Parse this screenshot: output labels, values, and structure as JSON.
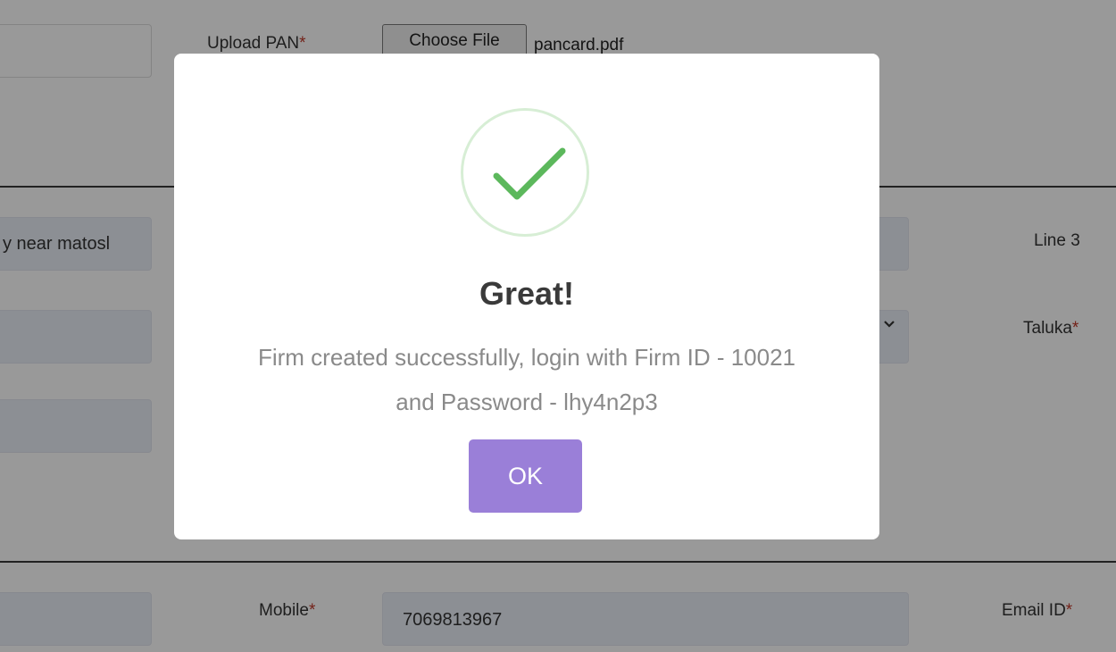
{
  "form": {
    "upload_pan_label": "Upload PAN",
    "required_mark": "*",
    "choose_file_label": "Choose File",
    "file_name": "pancard.pdf",
    "address_line1_value": "y near matosl",
    "line3_label": "Line 3",
    "taluka_label": "Taluka",
    "mobile_label": "Mobile",
    "mobile_value": "7069813967",
    "email_label": "Email ID"
  },
  "modal": {
    "title": "Great!",
    "message_line1": "Firm created successfully, login with Firm ID - 10021",
    "message_line2": "and Password - lhy4n2p3",
    "ok_label": "OK",
    "icon": "checkmark-icon"
  },
  "colors": {
    "overlay": "rgba(0,0,0,0.4)",
    "ok_button": "#9a7fd8",
    "checkmark": "#5cb85c",
    "required": "#c0392b"
  }
}
